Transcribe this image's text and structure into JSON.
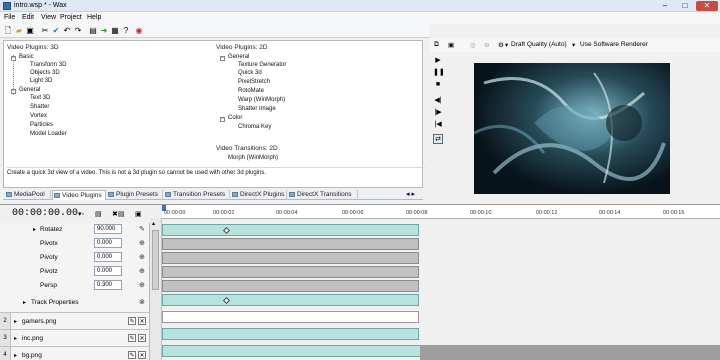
{
  "window": {
    "title": "intro.wsp * - Wax"
  },
  "menu": [
    "File",
    "Edit",
    "View",
    "Project",
    "Help"
  ],
  "plugins": {
    "video_3d": {
      "title": "Video Plugins: 3D",
      "groups": [
        {
          "label": "Basic",
          "items": [
            "Transform 3D",
            "Objects 3D",
            "Light 3D"
          ]
        },
        {
          "label": "General",
          "items": [
            "Text 3D",
            "Shatter",
            "Vortex",
            "Particles",
            "Model Loader"
          ]
        }
      ]
    },
    "video_2d": {
      "title": "Video Plugins: 2D",
      "groups": [
        {
          "label": "General",
          "items": [
            "Texture Generator",
            "Quick 3d",
            "PixelStretch",
            "RotoMate",
            "Warp (WinMorph)",
            "Shatter Image"
          ]
        },
        {
          "label": "Color",
          "items": [
            "Chroma Key"
          ]
        }
      ]
    },
    "transitions_2d": {
      "title": "Video Transitions: 2D",
      "items": [
        "Morph (WinMorph)"
      ]
    },
    "description": "Create a quick 3d view of a video. This is not a 3d plugin so cannot be used with other 3d plugins."
  },
  "tabs": [
    "MediaPool",
    "Video Plugins",
    "Plugin Presets",
    "Transition Presets",
    "DirectX Plugins",
    "DirectX Transitions"
  ],
  "preview": {
    "quality": "Draft Quality (Auto)",
    "renderer": "Use Software Renderer"
  },
  "timeline": {
    "time": "00:00:00.00",
    "ruler": [
      "00:00:00",
      "00:00:02",
      "00:00:04",
      "00:00:06",
      "00:00:08",
      "00:00:10",
      "00:00:12",
      "00:00:14",
      "00:00:16"
    ],
    "params": [
      {
        "label": "Rotatez",
        "value": "90.000"
      },
      {
        "label": "Pivotx",
        "value": "0.000"
      },
      {
        "label": "Pivoty",
        "value": "0.000"
      },
      {
        "label": "Pivotz",
        "value": "0.000"
      },
      {
        "label": "Persp",
        "value": "0.300"
      }
    ],
    "track_properties": "Track Properties",
    "tracks": [
      {
        "num": "2",
        "name": "gamers.png"
      },
      {
        "num": "3",
        "name": "inc.png"
      },
      {
        "num": "4",
        "name": "bg.png"
      }
    ]
  },
  "colors": {
    "clip_teal": "#b6e3e0",
    "clip_grey": "#c1c1c1",
    "accent": "#3a6fd0"
  }
}
